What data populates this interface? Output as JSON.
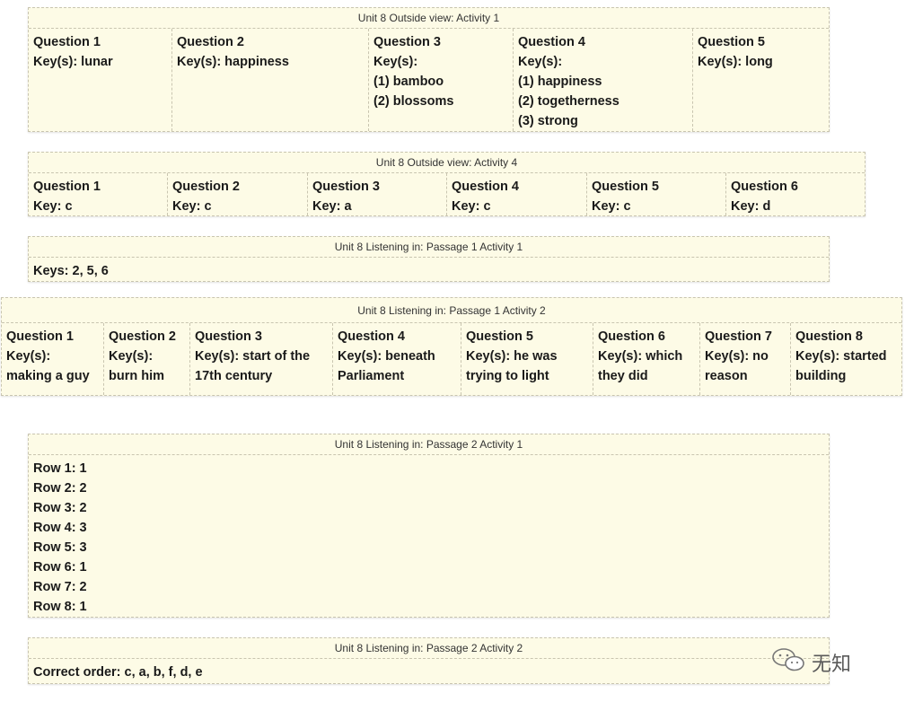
{
  "panels": {
    "p1": {
      "title": "Unit 8 Outside view: Activity 1",
      "cells": [
        {
          "label": "Question 1",
          "key": "Key(s): lunar"
        },
        {
          "label": "Question 2",
          "key": "Key(s): happiness"
        },
        {
          "label": "Question 3",
          "key": "Key(s):",
          "items": [
            "(1) bamboo",
            "(2) blossoms"
          ]
        },
        {
          "label": "Question 4",
          "key": "Key(s):",
          "items": [
            "(1) happiness",
            "(2) togetherness",
            "(3) strong"
          ]
        },
        {
          "label": "Question 5",
          "key": "Key(s): long"
        }
      ]
    },
    "p2": {
      "title": "Unit 8 Outside view: Activity 4",
      "cells": [
        {
          "label": "Question 1",
          "key": "Key: c"
        },
        {
          "label": "Question 2",
          "key": "Key: c"
        },
        {
          "label": "Question 3",
          "key": "Key: a"
        },
        {
          "label": "Question 4",
          "key": "Key: c"
        },
        {
          "label": "Question 5",
          "key": "Key: c"
        },
        {
          "label": "Question 6",
          "key": "Key: d"
        }
      ]
    },
    "p3": {
      "title": "Unit 8 Listening in: Passage 1 Activity 1",
      "text": "Keys: 2, 5, 6"
    },
    "p4": {
      "title": "Unit 8 Listening in: Passage 1 Activity 2",
      "cells": [
        {
          "label": "Question 1",
          "lines": [
            "Key(s):",
            "making a guy"
          ]
        },
        {
          "label": "Question 2",
          "lines": [
            "Key(s):",
            "burn him"
          ]
        },
        {
          "label": "Question 3",
          "lines": [
            "Key(s): start of the",
            "17th century"
          ]
        },
        {
          "label": "Question 4",
          "lines": [
            "Key(s): beneath",
            "Parliament"
          ]
        },
        {
          "label": "Question 5",
          "lines": [
            "Key(s): he was",
            "trying to light"
          ]
        },
        {
          "label": "Question 6",
          "lines": [
            "Key(s): which",
            "they did"
          ]
        },
        {
          "label": "Question 7",
          "lines": [
            "Key(s): no",
            "reason"
          ]
        },
        {
          "label": "Question 8",
          "lines": [
            "Key(s): started",
            "building"
          ]
        }
      ]
    },
    "p5": {
      "title": "Unit 8 Listening in: Passage 2 Activity 1",
      "rows": [
        "Row 1: 1",
        "Row 2: 2",
        "Row 3: 2",
        "Row 4: 3",
        "Row 5: 3",
        "Row 6: 1",
        "Row 7: 2",
        "Row 8: 1"
      ]
    },
    "p6": {
      "title": "Unit 8 Listening in: Passage 2 Activity 2",
      "text": "Correct order: c, a, b, f, d, e"
    }
  },
  "watermark": {
    "text": "无知",
    "icon": "wechat-icon"
  }
}
